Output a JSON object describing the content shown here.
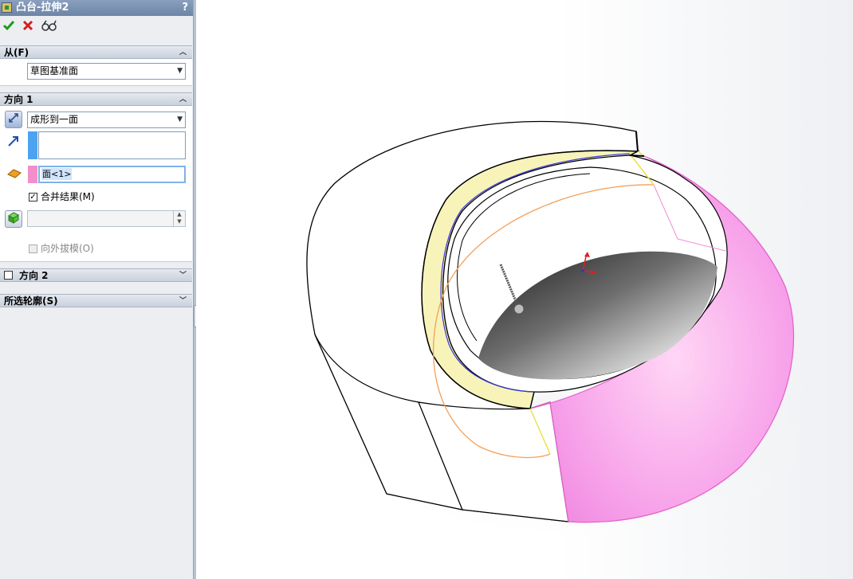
{
  "feature": {
    "title": "凸台-拉伸2",
    "help_label": "?",
    "ok_icon": "checkmark-icon",
    "cancel_icon": "x-icon",
    "preview_icon": "glasses-icon"
  },
  "from": {
    "header": "从(F)",
    "value": "草图基准面"
  },
  "direction1": {
    "header": "方向 1",
    "end_condition": "成形到一面",
    "selected_face": "面<1>",
    "merge_label": "合并结果(M)",
    "merge_checked": true,
    "draft_label": "向外拔模(O)",
    "draft_checked": false
  },
  "direction2": {
    "header": "方向 2",
    "checked": false
  },
  "contours": {
    "header": "所选轮廓(S)"
  },
  "colors": {
    "direction_bar": "#4da3f0",
    "face_bar": "#f28ec9",
    "face_surface": "#f7a3ea",
    "preview_ring": "#f8f3b9"
  }
}
